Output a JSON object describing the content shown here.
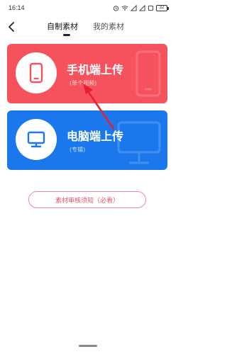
{
  "status_bar": {
    "time": "16:14",
    "battery": "32"
  },
  "nav": {
    "back_icon": "chevron-left-icon",
    "tabs": [
      {
        "label": "自制素材",
        "active": true
      },
      {
        "label": "我的素材",
        "active": false
      }
    ]
  },
  "cards": {
    "phone": {
      "title": "手机端上传",
      "subtitle": "(单个视频)",
      "icon": "phone-icon",
      "color": "#f5525e"
    },
    "pc": {
      "title": "电脑端上传",
      "subtitle": "(专辑)",
      "icon": "monitor-icon",
      "color": "#1a78ec"
    }
  },
  "notice_button": {
    "label": "素材审核须知（必看）",
    "color": "#e5566a"
  },
  "annotation": {
    "icon": "arrow-annotation-icon",
    "color": "#e8202a"
  }
}
